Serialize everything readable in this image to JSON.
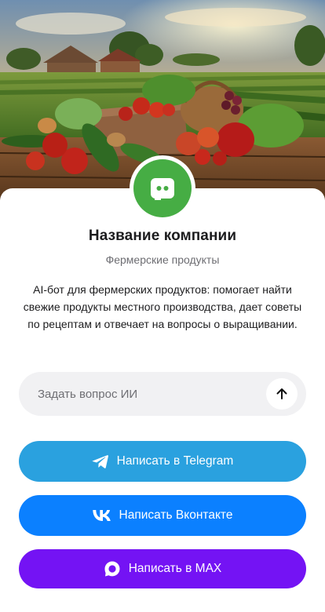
{
  "hero": {
    "image": "farm-vegetables-photo"
  },
  "profile": {
    "avatar_icon": "chat-bot-icon",
    "avatar_color": "#46ad44",
    "name": "Название компании",
    "category": "Фермерские продукты",
    "description": "AI-бот для фермерских продуктов: помогает найти свежие продукты местного производства, дает советы по рецептам и отвечает на вопросы о выращивании."
  },
  "ask": {
    "placeholder": "Задать вопрос ИИ",
    "value": "",
    "send_icon": "arrow-up-icon"
  },
  "buttons": {
    "telegram": {
      "label": "Написать в Telegram",
      "icon": "telegram-icon",
      "color": "#2aa1df"
    },
    "vk": {
      "label": "Написать Вконтакте",
      "icon": "vk-icon",
      "color": "#0b80ff"
    },
    "max": {
      "label": "Написать в MAX",
      "icon": "max-icon",
      "color": "#7413f4"
    }
  }
}
